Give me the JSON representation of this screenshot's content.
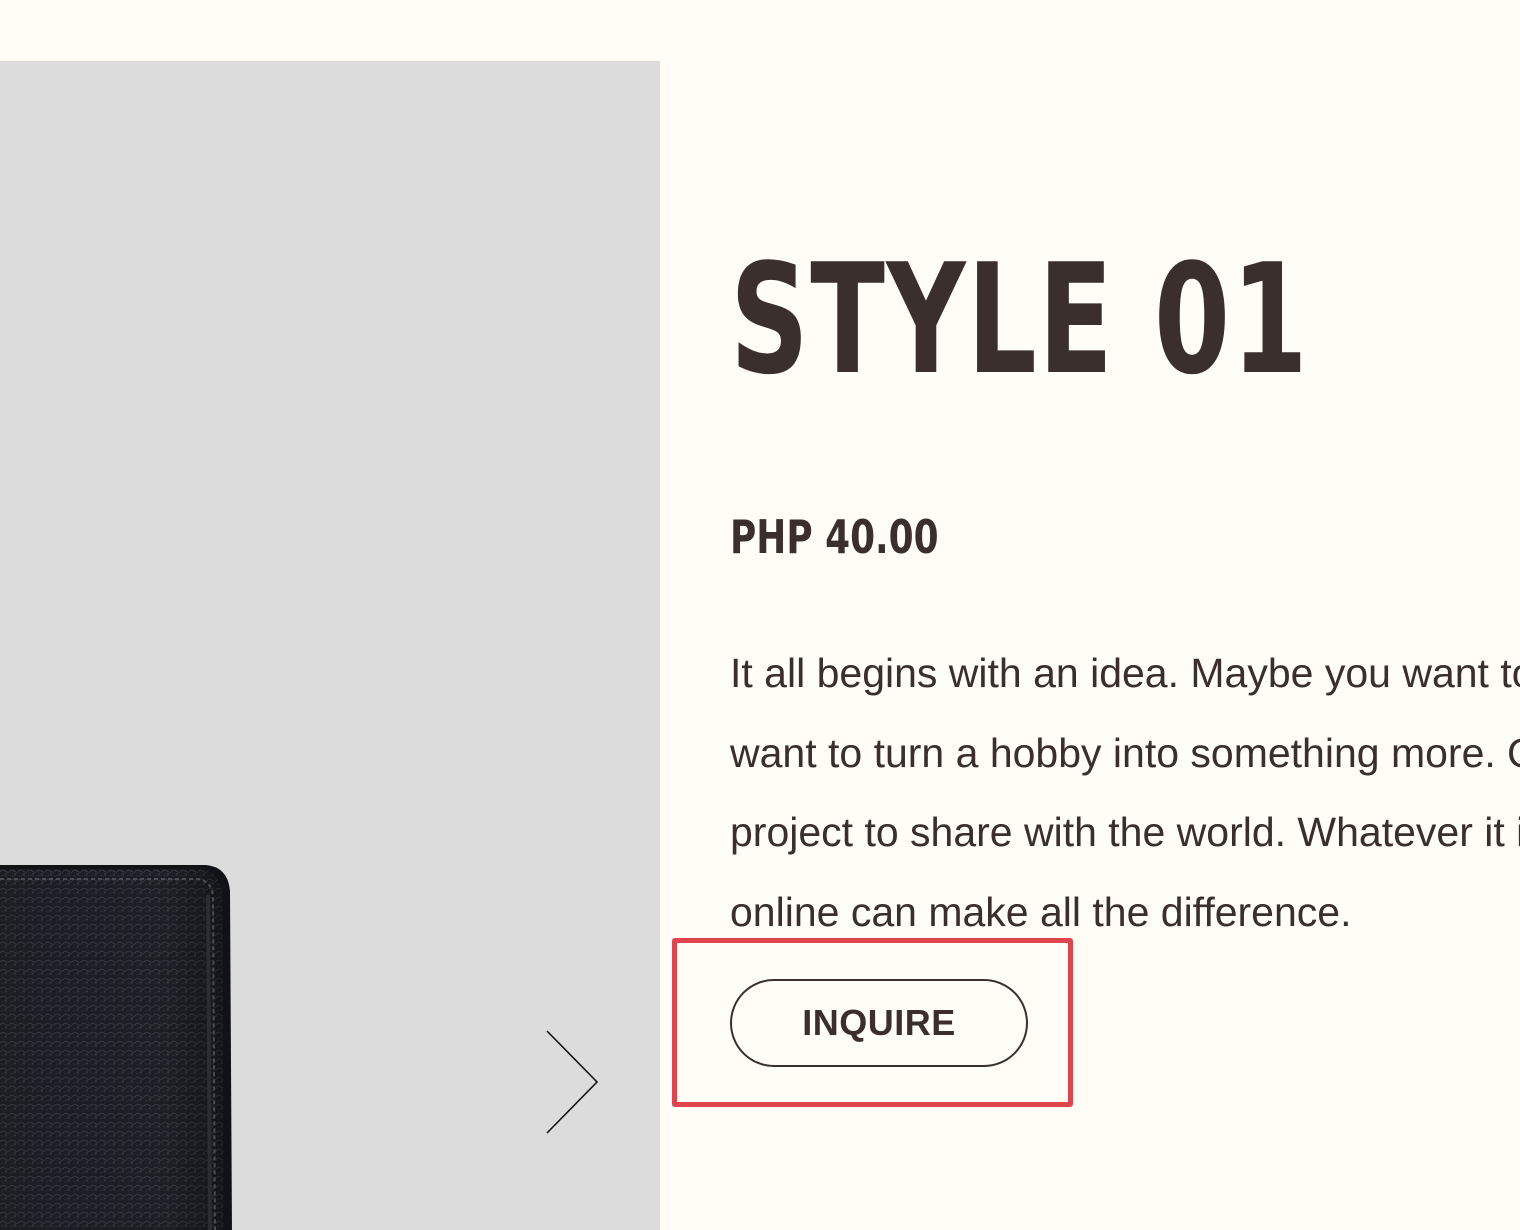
{
  "product": {
    "title": "STYLE 01",
    "price": "PHP 40.00",
    "description_lines": [
      "It all begins with an idea. Maybe you want to launch a business. Maybe you",
      "want to turn a hobby into something more. Or maybe you have a creative",
      "project to share with the world. Whatever it is, the way you tell your story",
      "online can make all the difference."
    ],
    "inquire_label": "INQUIRE"
  },
  "gallery": {
    "image": "black-leather-wallet",
    "next_icon": "chevron-right-icon"
  },
  "colors": {
    "page_background": "#fffdf6",
    "gallery_background": "#dcdcdc",
    "text": "#3a2f2c",
    "highlight": "#e0454d"
  }
}
